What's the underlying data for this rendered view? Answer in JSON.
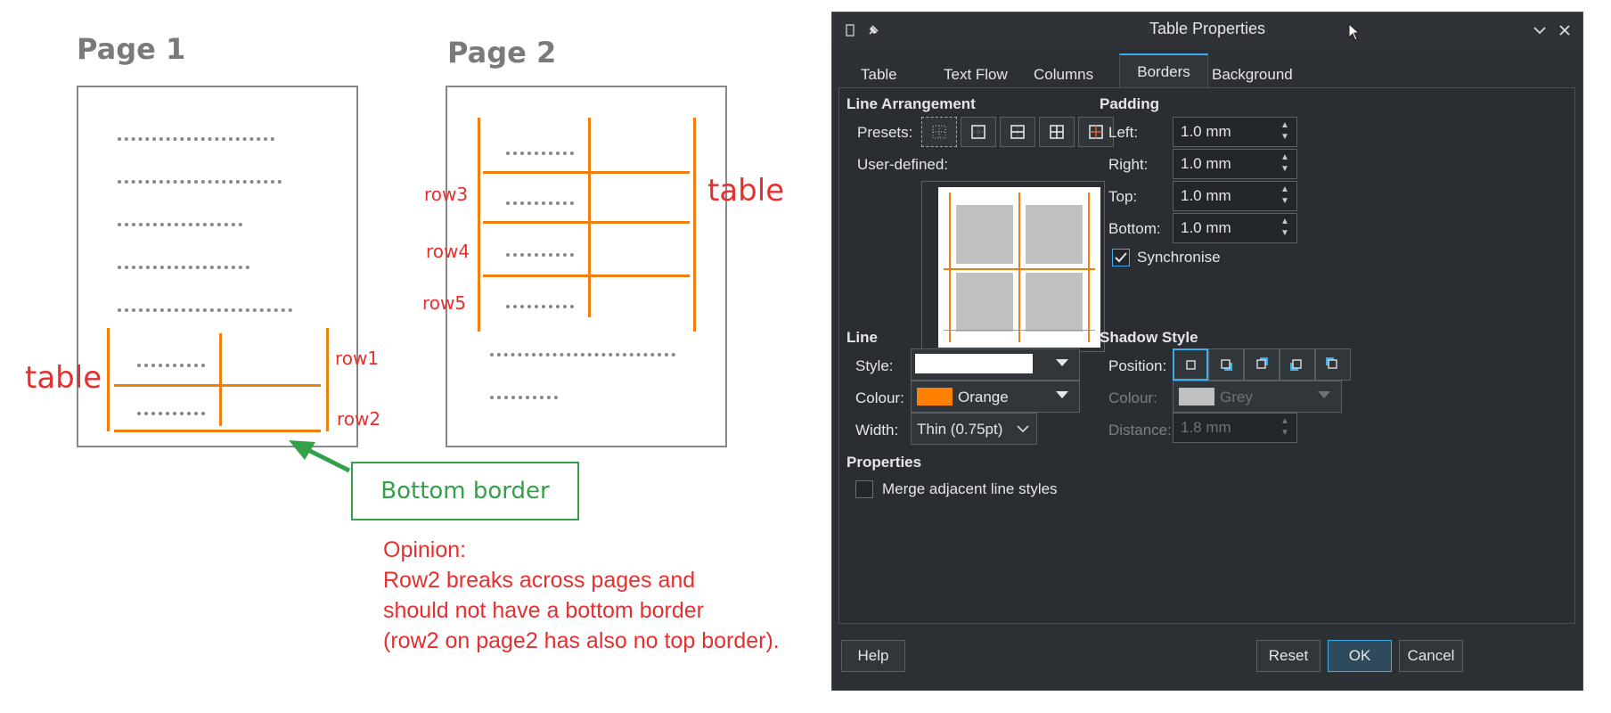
{
  "illustration": {
    "page1_title": "Page 1",
    "page2_title": "Page 2",
    "table_label_left": "table",
    "table_label_right": "table",
    "row_labels": [
      "row1",
      "row2",
      "row3",
      "row4",
      "row5"
    ],
    "callout": "Bottom border",
    "opinion_lines": [
      "Opinion:",
      "Row2 breaks across pages and",
      "should not have a bottom border",
      "(row2 on page2 has also no top border)."
    ]
  },
  "dialog": {
    "title": "Table Properties",
    "tabs": [
      "Table",
      "Text Flow",
      "Columns",
      "Borders",
      "Background"
    ],
    "active_tab": "Borders",
    "line_arrangement": {
      "heading": "Line Arrangement",
      "presets_label": "Presets:",
      "user_defined_label": "User-defined:"
    },
    "padding": {
      "heading": "Padding",
      "left_label": "Left:",
      "left_value": "1.0 mm",
      "right_label": "Right:",
      "right_value": "1.0 mm",
      "top_label": "Top:",
      "top_value": "1.0 mm",
      "bottom_label": "Bottom:",
      "bottom_value": "1.0 mm",
      "synchronise_label": "Synchronise",
      "synchronise_checked": true
    },
    "line": {
      "heading": "Line",
      "style_label": "Style:",
      "colour_label": "Colour:",
      "colour_value": "Orange",
      "colour_hex": "#ff8000",
      "width_label": "Width:",
      "width_value": "Thin (0.75pt)"
    },
    "shadow": {
      "heading": "Shadow Style",
      "position_label": "Position:",
      "colour_label": "Colour:",
      "colour_value": "Grey",
      "colour_hex": "#c0c0c0",
      "distance_label": "Distance:",
      "distance_value": "1.8 mm"
    },
    "properties": {
      "heading": "Properties",
      "merge_label": "Merge adjacent line styles",
      "merge_checked": false
    },
    "buttons": {
      "help": "Help",
      "reset": "Reset",
      "ok": "OK",
      "cancel": "Cancel"
    }
  },
  "colors": {
    "accent": "#3daee9",
    "annotation_red": "#e53030",
    "annotation_green": "#34a048",
    "border_orange": "#f07f0f"
  }
}
